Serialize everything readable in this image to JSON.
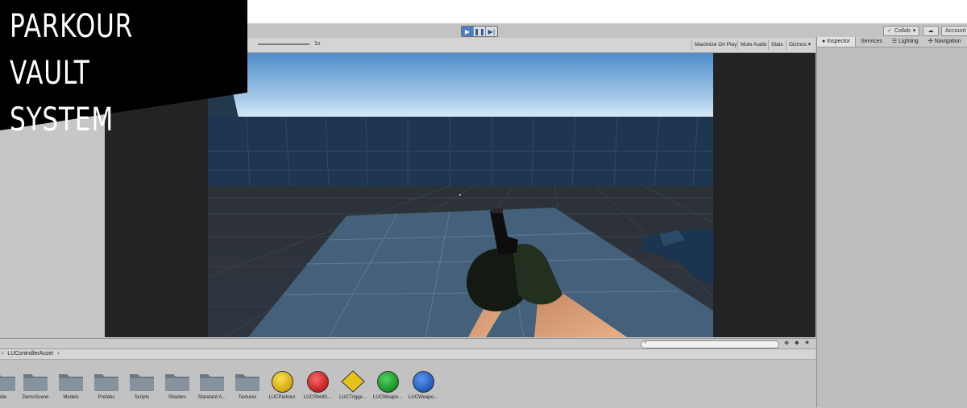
{
  "banner": {
    "title_line1": "Parkour Vault",
    "title_line2": "System"
  },
  "toolbar": {
    "play_icon": "play-icon",
    "pause_icon": "pause-icon",
    "step_icon": "step-icon",
    "collab_label": "Collab",
    "cloud_icon": "cloud-icon",
    "account_label": "Account"
  },
  "game_view": {
    "scale_label": "1x",
    "maximize_on_play": "Maximize On Play",
    "mute_audio": "Mute Audio",
    "stats": "Stats",
    "gizmos": "Gizmos"
  },
  "inspector": {
    "tabs": [
      {
        "label": "Inspector",
        "icon": "info-icon"
      },
      {
        "label": "Services"
      },
      {
        "label": "Lighting",
        "icon": "lighting-icon"
      },
      {
        "label": "Navigation",
        "icon": "navigation-icon"
      }
    ]
  },
  "project": {
    "breadcrumb": "LUControllerAsset",
    "assets": [
      {
        "label": "die",
        "type": "folder"
      },
      {
        "label": "DemoScene",
        "type": "folder"
      },
      {
        "label": "Models",
        "type": "folder"
      },
      {
        "label": "Prefabs",
        "type": "folder"
      },
      {
        "label": "Scripts",
        "type": "folder"
      },
      {
        "label": "Shaders",
        "type": "folder"
      },
      {
        "label": "Standard A...",
        "type": "folder"
      },
      {
        "label": "Textures",
        "type": "folder"
      },
      {
        "label": "LUCParkour",
        "type": "ball",
        "color": "#d9b215"
      },
      {
        "label": "LUCShellS...",
        "type": "ball",
        "color": "#d12626"
      },
      {
        "label": "LUCTrigge...",
        "type": "diamond",
        "color": "#e5c21a"
      },
      {
        "label": "LUCWeapo...",
        "type": "ball",
        "color": "#1f9a2c"
      },
      {
        "label": "LUCWeapo...",
        "type": "ball",
        "color": "#2763c4"
      }
    ]
  },
  "colors": {
    "accent": "#4b7ec8",
    "editor_bg": "#c2c2c2",
    "banner_bg": "#000000"
  }
}
